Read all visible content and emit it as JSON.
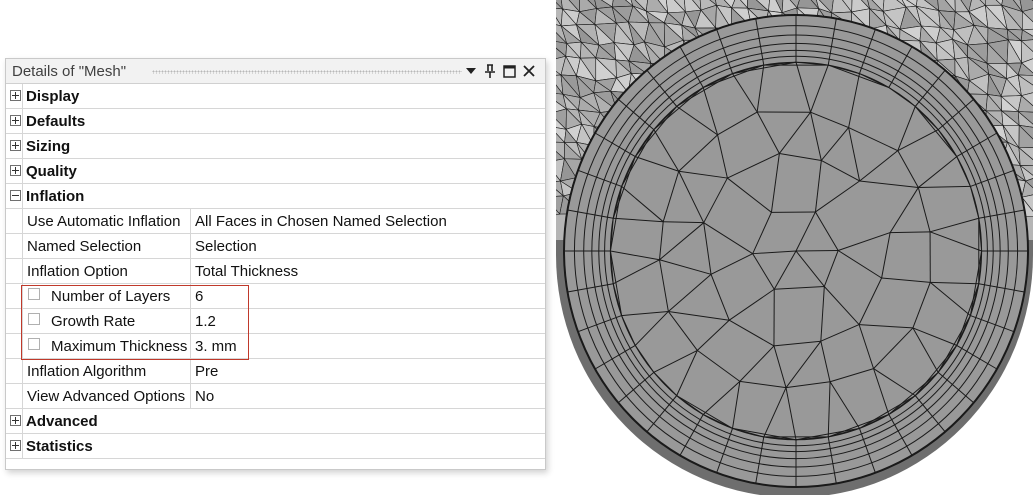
{
  "panel": {
    "title": "Details of \"Mesh\"",
    "buttons": {
      "dropdown": "▼",
      "pin": "⊥",
      "maximize": "□",
      "close": "✕"
    }
  },
  "categories": {
    "display": "Display",
    "defaults": "Defaults",
    "sizing": "Sizing",
    "quality": "Quality",
    "inflation": "Inflation",
    "advanced": "Advanced",
    "statistics": "Statistics"
  },
  "inflation": {
    "use_automatic_inflation": {
      "name": "Use Automatic Inflation",
      "value": "All Faces in Chosen Named Selection"
    },
    "named_selection": {
      "name": "Named Selection",
      "value": "Selection"
    },
    "inflation_option": {
      "name": "Inflation Option",
      "value": "Total Thickness"
    },
    "number_of_layers": {
      "name": "Number of Layers",
      "value": "6"
    },
    "growth_rate": {
      "name": "Growth Rate",
      "value": "1.2"
    },
    "maximum_thickness": {
      "name": "Maximum Thickness",
      "value": "3. mm"
    },
    "inflation_algorithm": {
      "name": "Inflation Algorithm",
      "value": "Pre"
    },
    "view_advanced_options": {
      "name": "View Advanced Options",
      "value": "No"
    }
  },
  "colors": {
    "highlight_border": "#c0392b",
    "mesh_fill": "#999999",
    "mesh_lines": "#1a1a1a"
  }
}
